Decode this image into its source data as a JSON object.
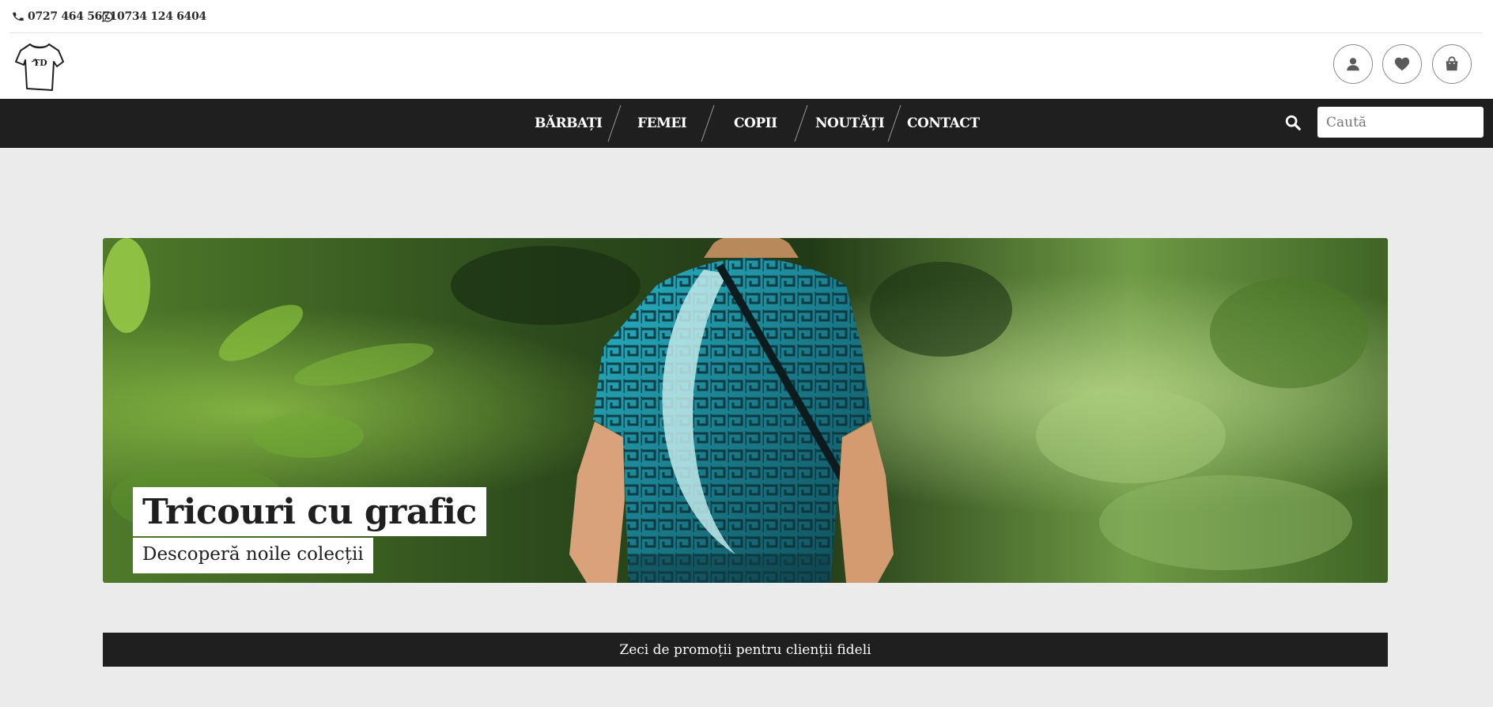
{
  "contact": {
    "phone": "0727 464 5671",
    "whatsapp": "0734 124 6404",
    "phone_icon": "phone-icon",
    "whatsapp_icon": "whatsapp-icon"
  },
  "header": {
    "logo_text": "TD",
    "icons": [
      "user-icon",
      "heart-icon",
      "shopping-bag-icon"
    ]
  },
  "nav": {
    "items": [
      {
        "label": "BĂRBAȚI"
      },
      {
        "label": "FEMEI"
      },
      {
        "label": "COPII"
      },
      {
        "label": "NOUTĂȚI"
      },
      {
        "label": "CONTACT"
      }
    ],
    "search_placeholder": "Caută",
    "search_icon": "search-icon"
  },
  "hero": {
    "title": "Tricouri cu grafic",
    "subtitle": "Descoperă noile colecții"
  },
  "promo": {
    "text": "Zeci de promoții pentru clienții fideli"
  },
  "colors": {
    "dark": "#1f1f1f",
    "background": "#ebebeb",
    "white": "#ffffff"
  }
}
